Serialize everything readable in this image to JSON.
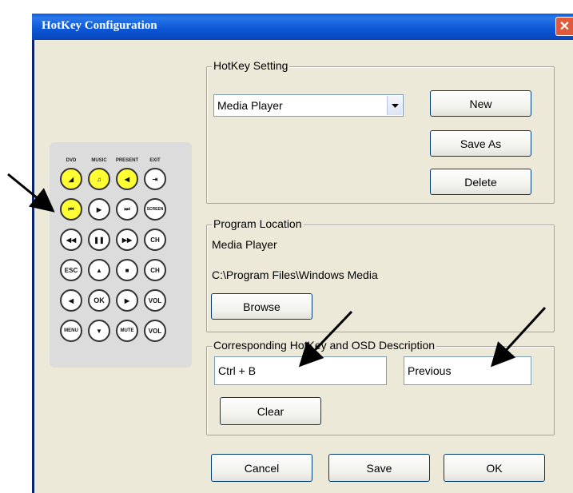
{
  "window": {
    "title": "HotKey Configuration",
    "close_symbol": "✕"
  },
  "hotkey_setting": {
    "label": "HotKey Setting",
    "selected": "Media Player",
    "buttons": {
      "new": "New",
      "save_as": "Save As",
      "delete": "Delete"
    }
  },
  "program_location": {
    "label": "Program Location",
    "name": "Media Player",
    "path": "C:\\Program Files\\Windows Media",
    "browse": "Browse"
  },
  "hotkey_osd": {
    "label": "Corresponding HotKey and OSD Description",
    "hotkey_value": "Ctrl + B",
    "osd_value": "Previous",
    "clear": "Clear"
  },
  "footer": {
    "cancel": "Cancel",
    "save": "Save",
    "ok": "OK"
  },
  "remote": {
    "labels": {
      "dvd": "DVD",
      "music": "MUSIC",
      "present": "PRESENT",
      "exit": "EXIT"
    },
    "keys": {
      "screen": "SCREEN",
      "ch": "CH",
      "esc": "ESC",
      "ok": "OK",
      "vol": "VOL",
      "menu": "MENU",
      "mute": "MUTE"
    },
    "highlighted_color": "#ffff33"
  }
}
